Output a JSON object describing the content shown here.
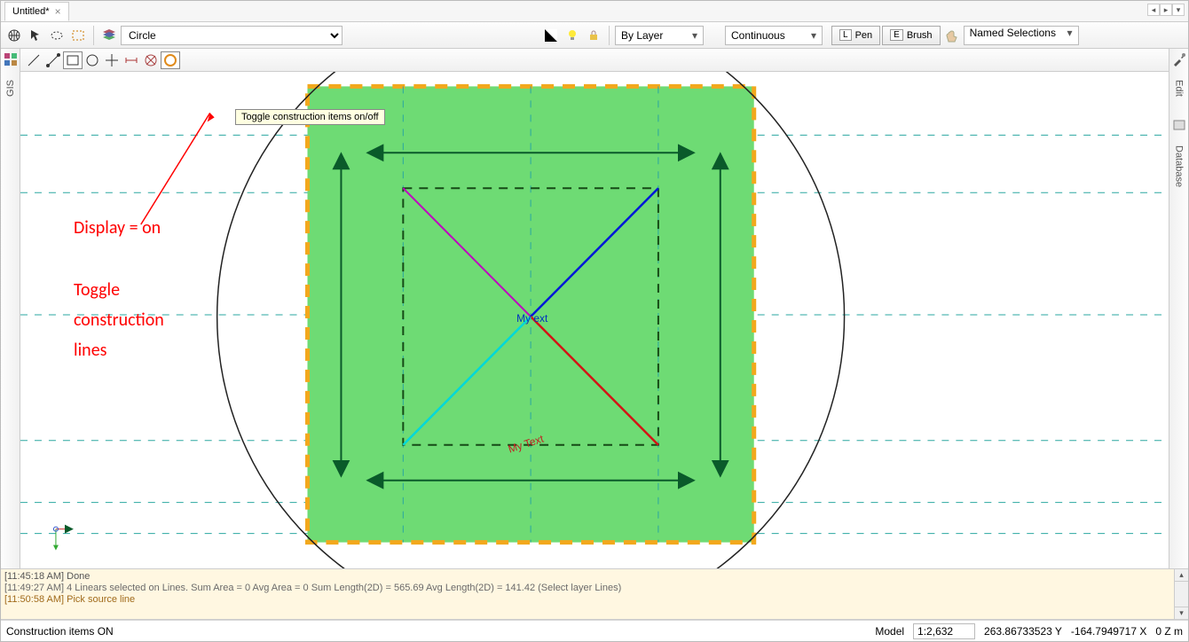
{
  "tab": {
    "title": "Untitled*",
    "close": "×"
  },
  "toolbar1": {
    "entity_type": "Circle",
    "layer_style": "By Layer",
    "line_style": "Continuous",
    "pen_key": "L",
    "pen_label": "Pen",
    "brush_key": "E",
    "brush_label": "Brush",
    "named_selections": "Named Selections"
  },
  "tooltip": "Toggle construction items on/off",
  "left_sidebar_label": "GIS",
  "right_sidebar": {
    "item1": "Edit",
    "item2": "Database"
  },
  "annotations": {
    "line1": "Display = on",
    "line2": "Toggle",
    "line3": "construction",
    "line4": "lines"
  },
  "canvas": {
    "text1": "My  ext",
    "text2": "My Text"
  },
  "log": {
    "l1": "[11:45:18 AM] Done",
    "l2": "[11:49:27 AM] 4 Linears selected on Lines.   Sum Area = 0   Avg Area = 0   Sum Length(2D) = 565.69  Avg Length(2D) = 141.42 (Select layer Lines)",
    "l3": "[11:50:58 AM] Pick source line"
  },
  "status": {
    "msg": "Construction items ON",
    "model_label": "Model",
    "scale": "1:2,632",
    "y": "263.86733523 Y",
    "x": "-164.7949717 X",
    "z": "0  Z m"
  }
}
